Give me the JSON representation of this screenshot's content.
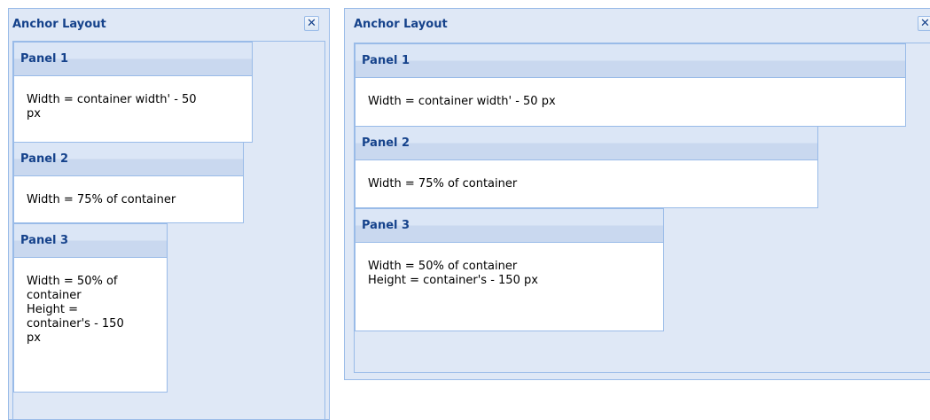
{
  "left_window": {
    "title": "Anchor Layout",
    "close_glyph": "✕",
    "panels": [
      {
        "title": "Panel 1",
        "lines": [
          "Width = container width' - 50",
          "px"
        ]
      },
      {
        "title": "Panel 2",
        "lines": [
          "Width = 75% of container"
        ]
      },
      {
        "title": "Panel 3",
        "lines": [
          "Width = 50% of",
          "container",
          "Height =",
          "container's - 150",
          "px"
        ]
      }
    ]
  },
  "right_window": {
    "title": "Anchor Layout",
    "close_glyph": "✕",
    "panels": [
      {
        "title": "Panel 1",
        "lines": [
          "Width = container width' - 50 px"
        ]
      },
      {
        "title": "Panel 2",
        "lines": [
          "Width = 75% of container"
        ]
      },
      {
        "title": "Panel 3",
        "lines": [
          "Width = 50% of container",
          "Height = container's - 150 px"
        ]
      }
    ]
  },
  "colors": {
    "window_bg": "#dfe8f6",
    "border": "#99bbe8",
    "header_text": "#15428b",
    "panel_header_bg": "#d3e0f3"
  }
}
